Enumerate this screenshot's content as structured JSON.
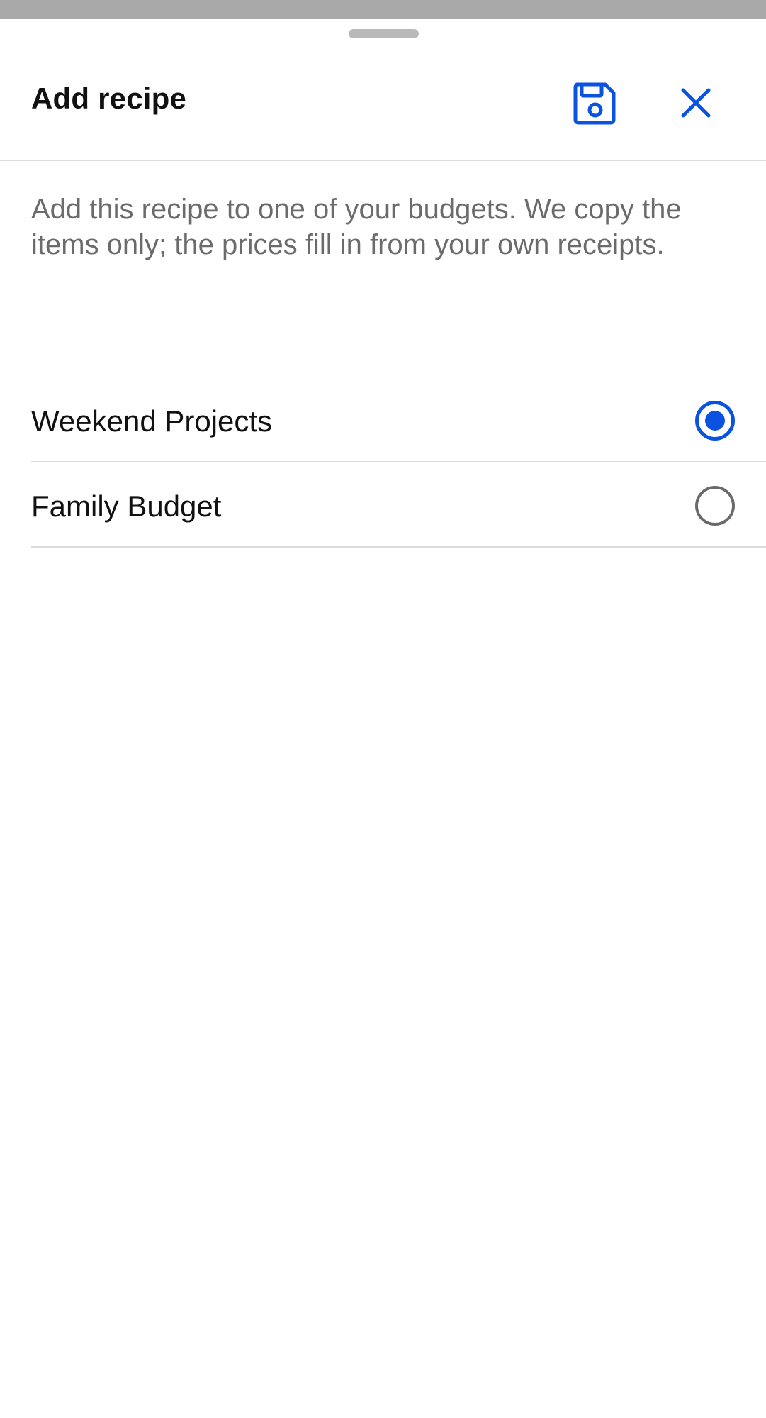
{
  "sheet": {
    "title": "Add recipe",
    "description": "Add this recipe to one of your budgets. We copy the items only; the prices fill in from your own receipts."
  },
  "actions": {
    "save_icon": "save-icon",
    "close_icon": "close-icon"
  },
  "budgets": [
    {
      "label": "Weekend Projects",
      "selected": true
    },
    {
      "label": "Family Budget",
      "selected": false
    }
  ],
  "colors": {
    "accent": "#0a53e0",
    "text": "#111111",
    "secondary_text": "#6b6b6b",
    "divider": "#dcdcdc"
  }
}
